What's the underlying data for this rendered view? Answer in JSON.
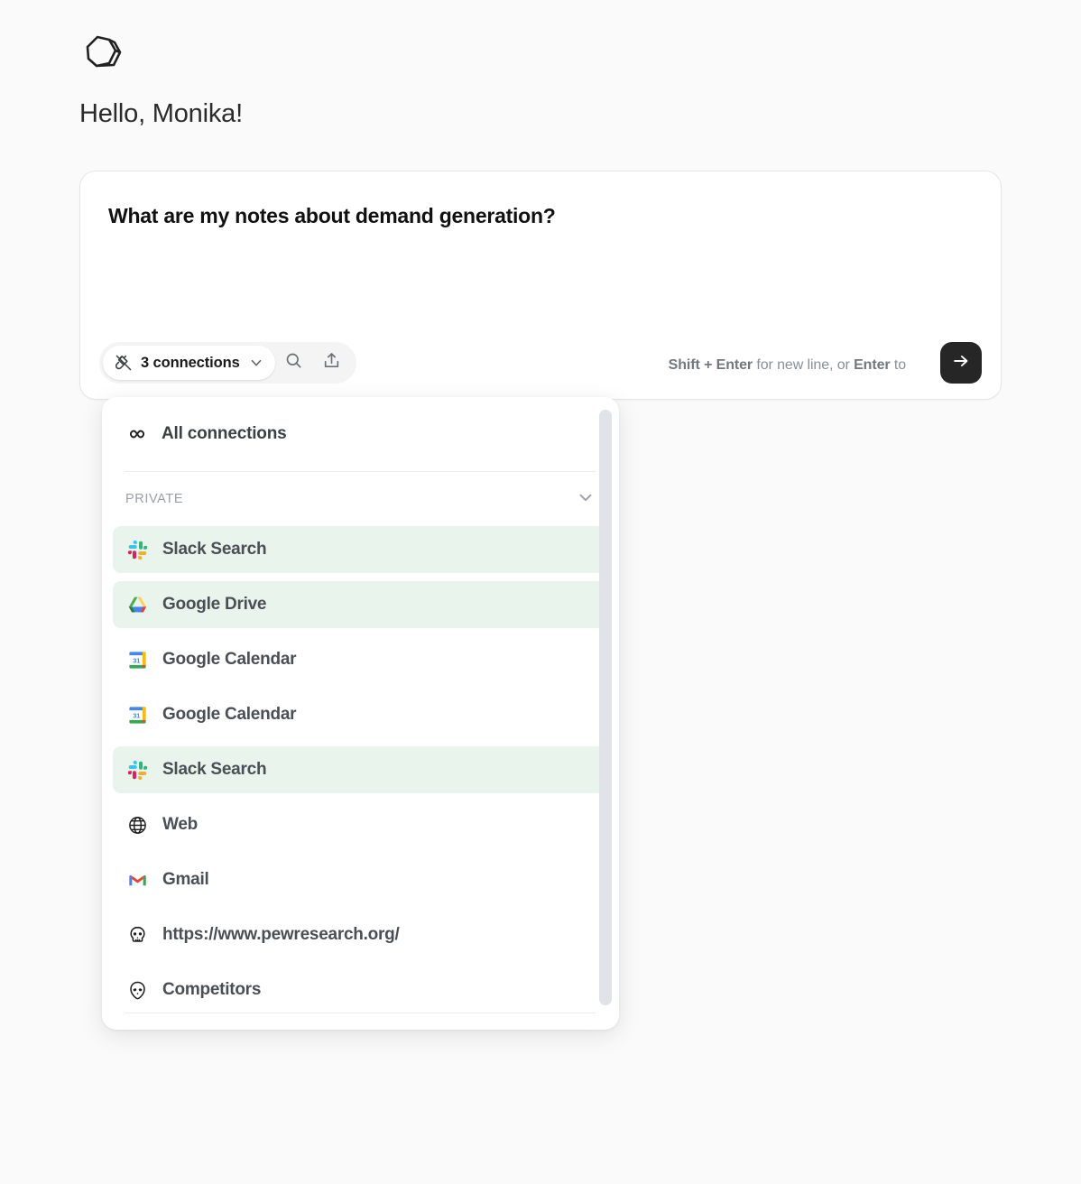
{
  "app": {
    "logo_icon": "rock-logo-icon",
    "background_color": "#fafafa"
  },
  "greeting": {
    "text": "Hello, Monika!"
  },
  "composer": {
    "query_text": "What are my notes about demand generation?",
    "toolbar": {
      "plug_icon": "plug-icon",
      "connections_label": "3 connections",
      "chevron_icon": "chevron-down-icon",
      "search_icon": "search-icon",
      "upload_icon": "upload-icon"
    },
    "hint": {
      "shift_enter": "Shift + Enter",
      "middle": " for new line, or ",
      "enter": "Enter",
      "tail": " to"
    },
    "send_button": {
      "icon": "arrow-right-icon",
      "background_color": "#262626"
    }
  },
  "dropdown": {
    "all_connections": {
      "icon": "infinity-icon",
      "label": "All connections"
    },
    "section": {
      "label": "PRIVATE",
      "chevron_icon": "chevron-down-icon"
    },
    "selected_highlight_color": "#e8f4ec",
    "items": [
      {
        "label": "Slack Search",
        "icon": "slack-icon",
        "selected": true
      },
      {
        "label": "Google Drive",
        "icon": "google-drive-icon",
        "selected": true
      },
      {
        "label": "Google Calendar",
        "icon": "google-calendar-icon",
        "selected": false
      },
      {
        "label": "Google Calendar",
        "icon": "google-calendar-icon",
        "selected": false
      },
      {
        "label": "Slack Search",
        "icon": "slack-icon",
        "selected": true
      },
      {
        "label": "Web",
        "icon": "globe-icon",
        "selected": false
      },
      {
        "label": "Gmail",
        "icon": "gmail-icon",
        "selected": false
      },
      {
        "label": "https://www.pewresearch.org/",
        "icon": "skull-icon",
        "selected": false
      },
      {
        "label": "Competitors",
        "icon": "alien-icon",
        "selected": false
      }
    ],
    "scrollbar": {
      "visible": true
    }
  }
}
